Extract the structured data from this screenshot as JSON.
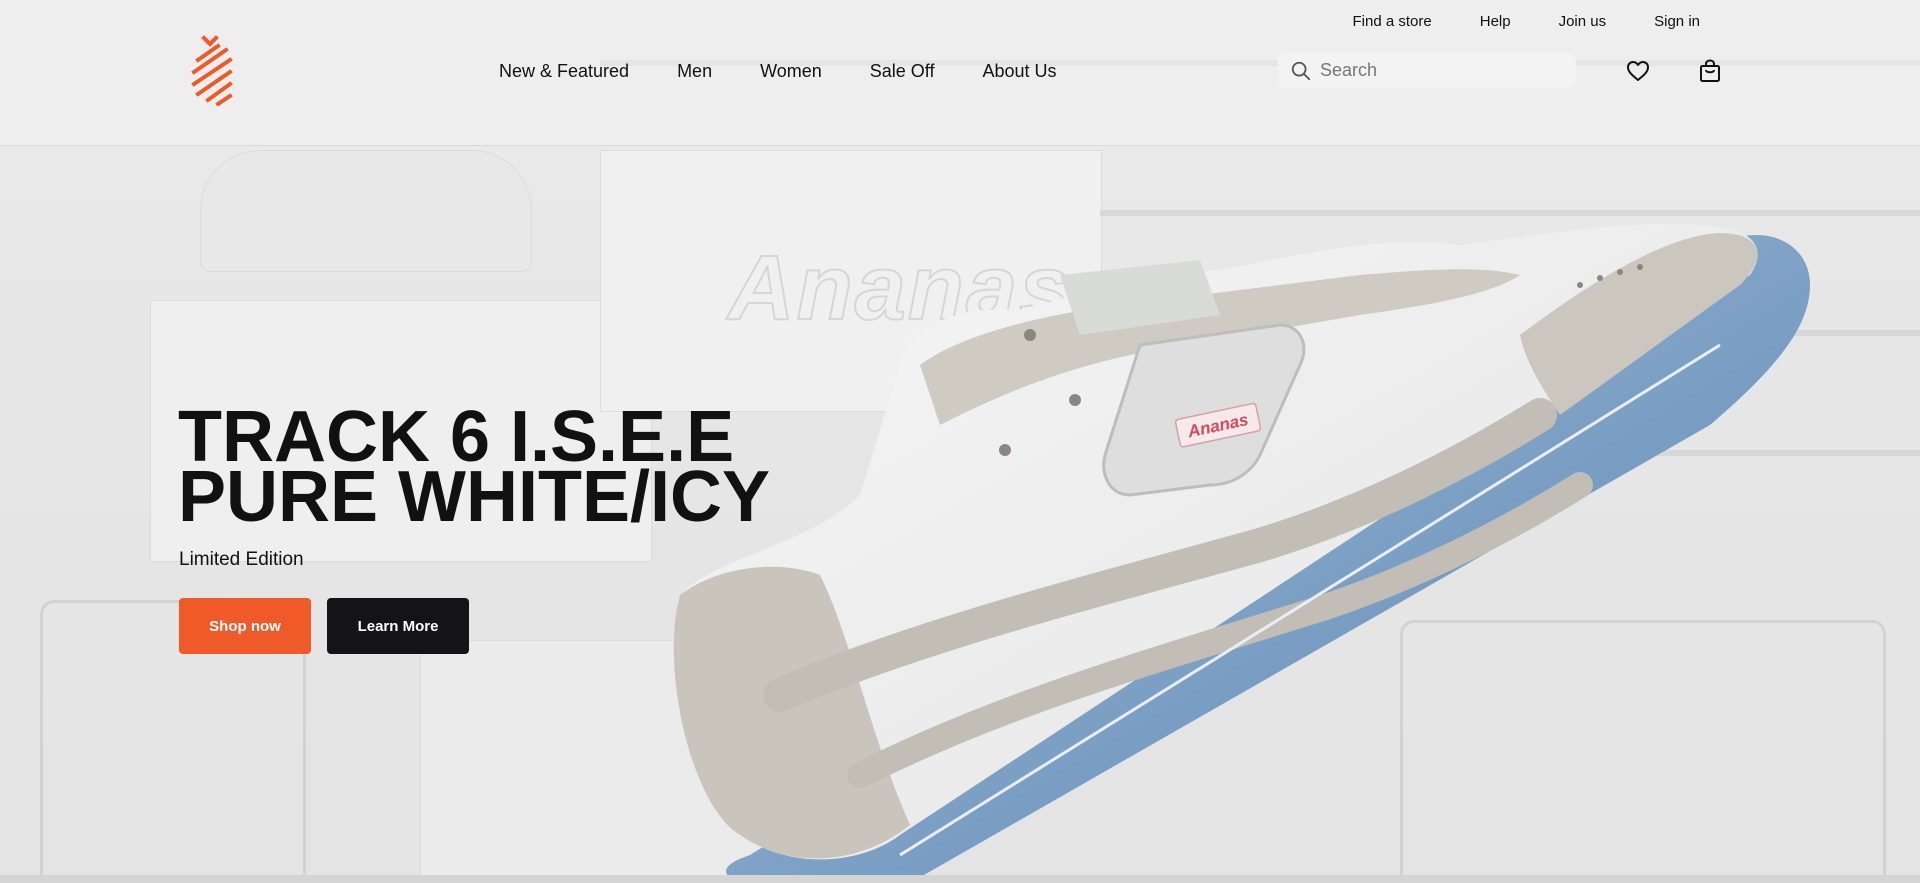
{
  "brand": {
    "logo_icon": "pineapple-stripes-logo",
    "accent_color": "#f05a28"
  },
  "utility_nav": {
    "items": [
      {
        "label": "Find a store"
      },
      {
        "label": "Help"
      },
      {
        "label": "Join us"
      },
      {
        "label": "Sign in"
      }
    ]
  },
  "main_nav": {
    "items": [
      {
        "label": "New & Featured"
      },
      {
        "label": "Men"
      },
      {
        "label": "Women"
      },
      {
        "label": "Sale Off"
      },
      {
        "label": "About Us"
      }
    ]
  },
  "search": {
    "placeholder": "Search",
    "value": "",
    "icon": "search-icon"
  },
  "header_icons": {
    "favorites_icon": "heart-icon",
    "bag_icon": "shopping-bag-icon"
  },
  "hero": {
    "title_line1": "TRACK 6 I.S.E.E",
    "title_line2": "PURE WHITE/ICY",
    "subtitle": "Limited Edition",
    "primary_button": "Shop now",
    "secondary_button": "Learn More",
    "primary_color": "#f05a28",
    "secondary_color": "#141418",
    "product_tag": "Ananas"
  }
}
